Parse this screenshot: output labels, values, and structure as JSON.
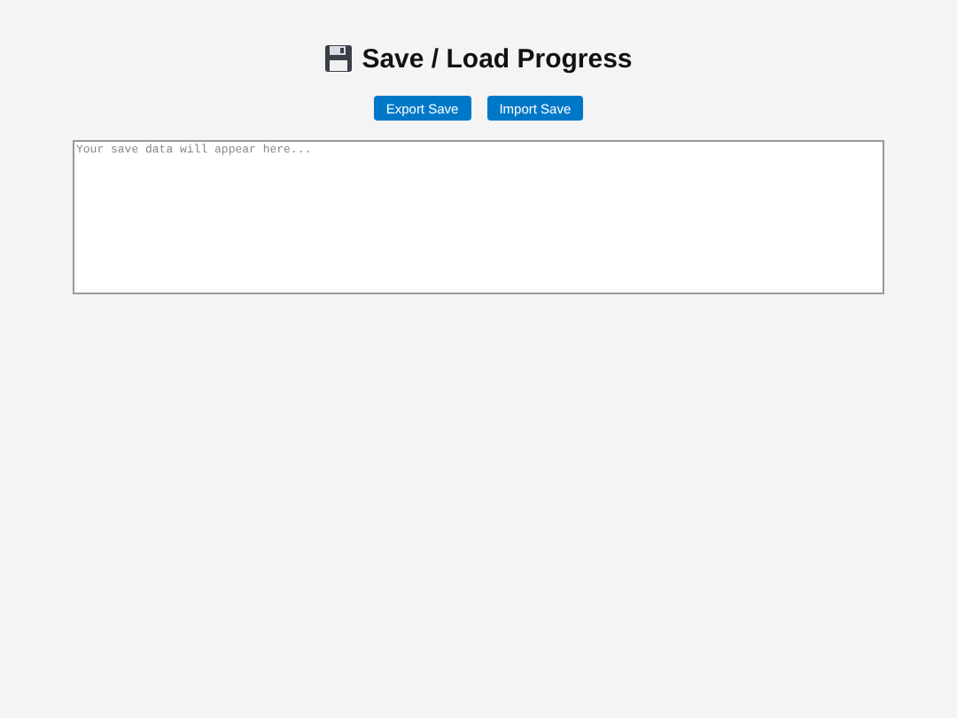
{
  "title": "Save / Load Progress",
  "buttons": [
    "Export Save",
    "Import Save"
  ],
  "save_data": {
    "placeholder": "Your save data will appear here..."
  }
}
